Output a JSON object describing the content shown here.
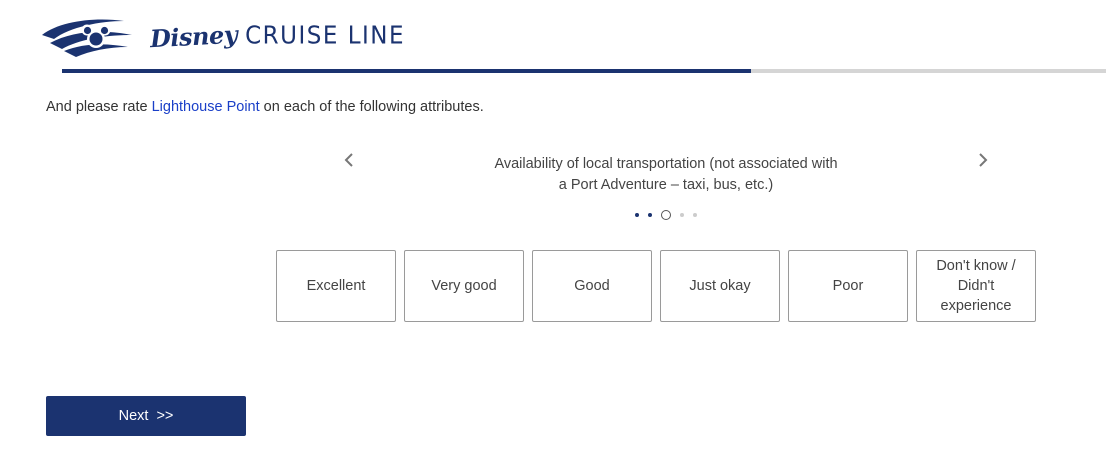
{
  "header": {
    "brand_script": "Disney",
    "brand_name": "CRUISE LINE",
    "logo_icon": "disney-cruise-line-logo-icon"
  },
  "progress": {
    "fraction": 0.66
  },
  "question": {
    "prefix": "And please rate ",
    "highlight": "Lighthouse Point",
    "suffix": " on each of the following attributes."
  },
  "carousel": {
    "prev_icon": "chevron-left-icon",
    "next_icon": "chevron-right-icon",
    "attribute_line1": "Availability of local transportation (not associated with",
    "attribute_line2": "a Port Adventure – taxi, bus, etc.)",
    "dots": [
      "completed",
      "completed",
      "current",
      "future",
      "future"
    ]
  },
  "options": [
    {
      "label": "Excellent"
    },
    {
      "label": "Very good"
    },
    {
      "label": "Good"
    },
    {
      "label": "Just okay"
    },
    {
      "label": "Poor"
    },
    {
      "label_line1": "Don't know /",
      "label_line2": "Didn't",
      "label_line3": "experience"
    }
  ],
  "navigation": {
    "next_label": "Next  >>"
  },
  "colors": {
    "brand": "#1b3370",
    "highlight": "#1a3fc8",
    "border": "#9a9a9a",
    "track": "#d5d5d5"
  }
}
